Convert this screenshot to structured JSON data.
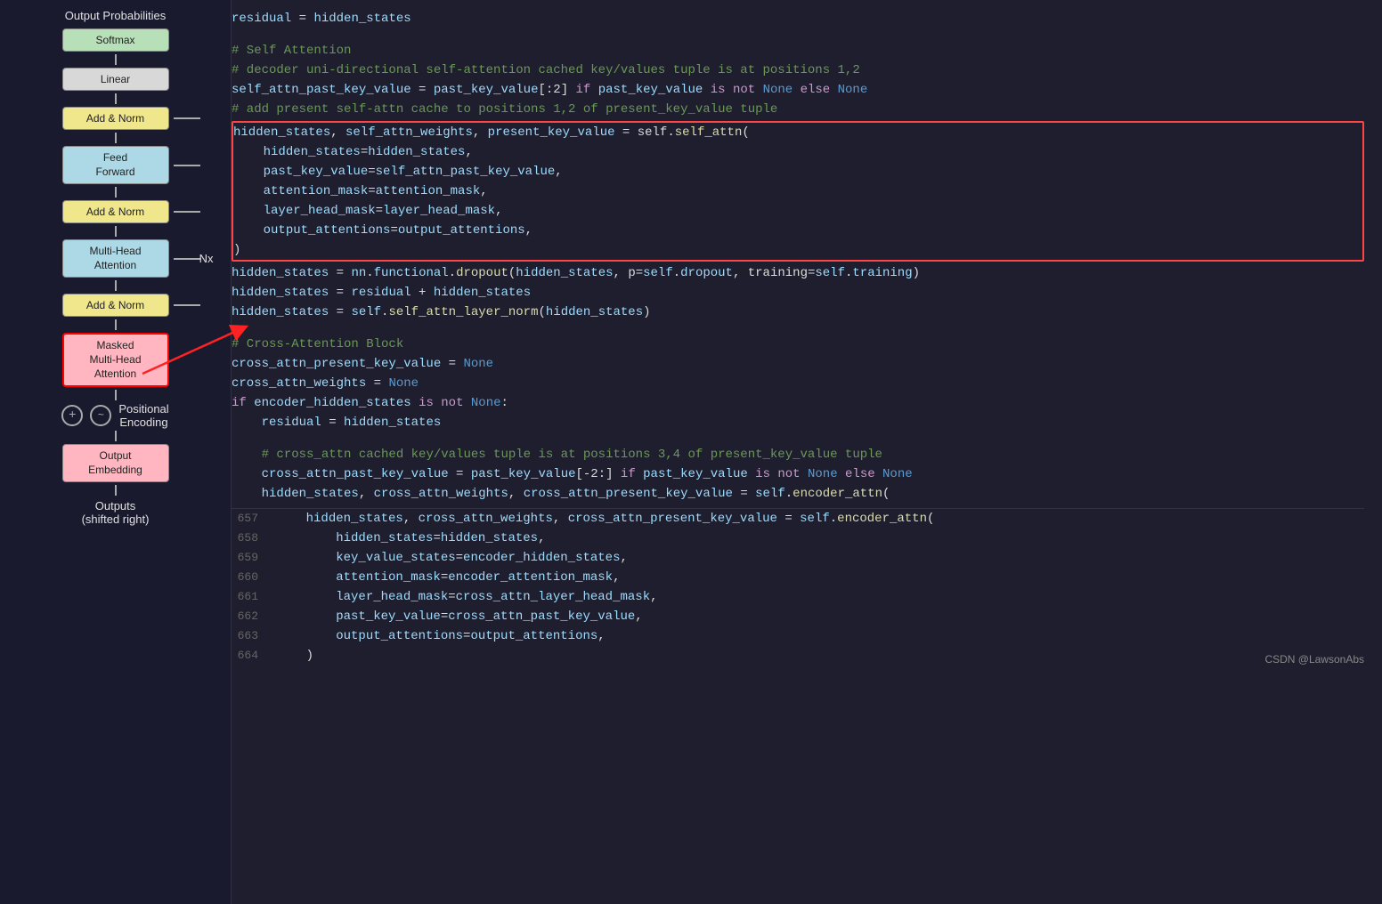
{
  "diagram": {
    "title_top": "Output\nProbabilities",
    "boxes": [
      {
        "id": "softmax",
        "label": "Softmax",
        "type": "green"
      },
      {
        "id": "linear",
        "label": "Linear",
        "type": "light"
      },
      {
        "id": "add-norm-3",
        "label": "Add & Norm",
        "type": "yellow"
      },
      {
        "id": "feed-forward",
        "label": "Feed\nForward",
        "type": "blue"
      },
      {
        "id": "add-norm-2",
        "label": "Add & Norm",
        "type": "yellow"
      },
      {
        "id": "multi-head-attn",
        "label": "Multi-Head\nAttention",
        "type": "blue"
      },
      {
        "id": "add-norm-1",
        "label": "Add & Norm",
        "type": "yellow"
      },
      {
        "id": "masked-mha",
        "label": "Masked\nMulti-Head\nAttention",
        "type": "pink-selected"
      }
    ],
    "nx_label": "Nx",
    "positional_label": "Positional\nEncoding",
    "output_embedding_label": "Output\nEmbedding",
    "outputs_label": "Outputs\n(shifted right)"
  },
  "code": {
    "top_lines": [
      {
        "content": "residual = hidden_states",
        "parts": [
          {
            "text": "residual",
            "cls": "var"
          },
          {
            "text": " = ",
            "cls": "plain"
          },
          {
            "text": "hidden_states",
            "cls": "var"
          }
        ]
      },
      {
        "content": "",
        "parts": []
      },
      {
        "content": "# Self Attention",
        "parts": [
          {
            "text": "# Self Attention",
            "cls": "cm"
          }
        ]
      },
      {
        "content": "# decoder uni-directional self-attention cached key/values tuple is at positions 1,2",
        "parts": [
          {
            "text": "# decoder uni-directional self-attention cached key/values tuple is at positions 1,2",
            "cls": "cm"
          }
        ]
      },
      {
        "content": "self_attn_past_key_value = past_key_value[:2] if past_key_value is not None else None",
        "parts": [
          {
            "text": "self_attn_past_key_value",
            "cls": "var"
          },
          {
            "text": " = ",
            "cls": "plain"
          },
          {
            "text": "past_key_value",
            "cls": "var"
          },
          {
            "text": "[:2] ",
            "cls": "plain"
          },
          {
            "text": "if",
            "cls": "kw"
          },
          {
            "text": " past_key_value ",
            "cls": "var"
          },
          {
            "text": "is not",
            "cls": "kw"
          },
          {
            "text": " None ",
            "cls": "none-kw"
          },
          {
            "text": "else",
            "cls": "kw"
          },
          {
            "text": " None",
            "cls": "none-kw"
          }
        ]
      },
      {
        "content": "# add present self-attn cache to positions 1,2 of present_key_value tuple",
        "parts": [
          {
            "text": "# add present self-attn cache to positions 1,2 of present_key_value tuple",
            "cls": "cm"
          }
        ]
      }
    ],
    "highlighted_block": [
      {
        "content": "hidden_states, self_attn_weights, present_key_value = self.self_attn(",
        "indent": 0
      },
      {
        "content": "    hidden_states=hidden_states,",
        "indent": 4
      },
      {
        "content": "    past_key_value=self_attn_past_key_value,",
        "indent": 4
      },
      {
        "content": "    attention_mask=attention_mask,",
        "indent": 4
      },
      {
        "content": "    layer_head_mask=layer_head_mask,",
        "indent": 4
      },
      {
        "content": "    output_attentions=output_attentions,",
        "indent": 4
      },
      {
        "content": ")",
        "indent": 0
      }
    ],
    "after_block": [
      {
        "content": "hidden_states = nn.functional.dropout(hidden_states, p=self.dropout, training=self.training)"
      },
      {
        "content": "hidden_states = residual + hidden_states"
      },
      {
        "content": "hidden_states = self.self_attn_layer_norm(hidden_states)"
      },
      {
        "content": ""
      },
      {
        "content": "# Cross-Attention Block",
        "type": "cm"
      },
      {
        "content": "cross_attn_present_key_value = None",
        "type": "assign-none"
      },
      {
        "content": "cross_attn_weights = None",
        "type": "assign-none"
      },
      {
        "content": "if encoder_hidden_states is not None:",
        "type": "if"
      },
      {
        "content": "    residual = hidden_states",
        "type": "assign-indent"
      },
      {
        "content": ""
      },
      {
        "content": "    # cross_attn cached key/values tuple is at positions 3,4 of present_key_value tuple",
        "type": "cm-indent"
      },
      {
        "content": "    cross_attn_past_key_value = past_key_value[-2:] if past_key_value is not None else None",
        "type": "assign-indent"
      },
      {
        "content": "    hidden_states, cross_attn_weights, cross_attn_present_key_value = self.encoder_attn(",
        "type": "call-indent"
      }
    ],
    "numbered_lines": [
      {
        "num": "657",
        "content": "    hidden_states, cross_attn_weights, cross_attn_present_key_value = self.encoder_attn("
      },
      {
        "num": "658",
        "content": "        hidden_states=hidden_states,"
      },
      {
        "num": "659",
        "content": "        key_value_states=encoder_hidden_states,"
      },
      {
        "num": "660",
        "content": "        attention_mask=encoder_attention_mask,"
      },
      {
        "num": "661",
        "content": "        layer_head_mask=cross_attn_layer_head_mask,"
      },
      {
        "num": "662",
        "content": "        past_key_value=cross_attn_past_key_value,"
      },
      {
        "num": "663",
        "content": "        output_attentions=output_attentions,"
      },
      {
        "num": "664",
        "content": "    )"
      }
    ]
  },
  "watermark": "CSDN @LawsonAbs"
}
